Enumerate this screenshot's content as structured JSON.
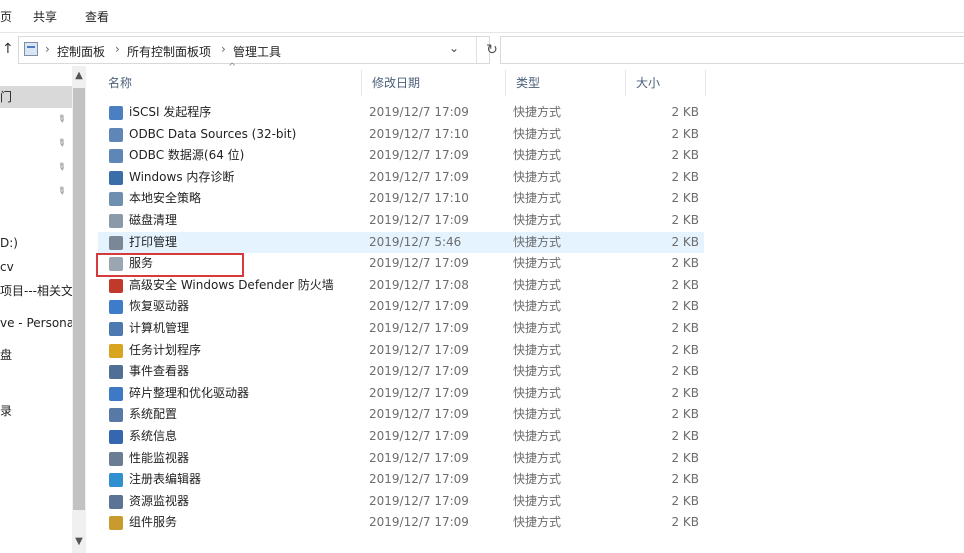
{
  "ribbon": {
    "tab_view_partial": "页",
    "tab_share": "共享",
    "tab_view": "查看"
  },
  "address": {
    "crumbs": [
      "控制面板",
      "所有控制面板项",
      "管理工具"
    ],
    "up_glyph": "↑",
    "dropdown_glyph": "⌄",
    "refresh_glyph": "↻"
  },
  "nav": {
    "items": [
      {
        "label": "门",
        "selected": true
      },
      {
        "label": ""
      },
      {
        "label": ""
      },
      {
        "label": ""
      },
      {
        "label": ""
      },
      {
        "label": ""
      },
      {
        "label": ""
      },
      {
        "label": "D:)"
      },
      {
        "label": "cv"
      },
      {
        "label": "项目---相关文"
      },
      {
        "label": "ve - Personal"
      },
      {
        "label": "盘"
      },
      {
        "label": ""
      },
      {
        "label": "录"
      }
    ],
    "pin_glyph": "📌"
  },
  "columns": {
    "name": "名称",
    "date": "修改日期",
    "type": "类型",
    "size": "大小",
    "sort_glyph": "^"
  },
  "files": [
    {
      "name": "iSCSI 发起程序",
      "date": "2019/12/7 17:09",
      "type": "快捷方式",
      "size": "2 KB",
      "icon": "iscsi-icon",
      "color": "#4a7fc1"
    },
    {
      "name": "ODBC Data Sources (32-bit)",
      "date": "2019/12/7 17:10",
      "type": "快捷方式",
      "size": "2 KB",
      "icon": "odbc-icon",
      "color": "#5e87b8"
    },
    {
      "name": "ODBC 数据源(64 位)",
      "date": "2019/12/7 17:09",
      "type": "快捷方式",
      "size": "2 KB",
      "icon": "odbc-icon",
      "color": "#5e87b8"
    },
    {
      "name": "Windows 内存诊断",
      "date": "2019/12/7 17:09",
      "type": "快捷方式",
      "size": "2 KB",
      "icon": "memory-diagnostic-icon",
      "color": "#3b6ea8"
    },
    {
      "name": "本地安全策略",
      "date": "2019/12/7 17:10",
      "type": "快捷方式",
      "size": "2 KB",
      "icon": "security-policy-icon",
      "color": "#6f8fb0"
    },
    {
      "name": "磁盘清理",
      "date": "2019/12/7 17:09",
      "type": "快捷方式",
      "size": "2 KB",
      "icon": "disk-cleanup-icon",
      "color": "#8b9aa8"
    },
    {
      "name": "打印管理",
      "date": "2019/12/7 5:46",
      "type": "快捷方式",
      "size": "2 KB",
      "icon": "print-management-icon",
      "color": "#7a8796"
    },
    {
      "name": "服务",
      "date": "2019/12/7 17:09",
      "type": "快捷方式",
      "size": "2 KB",
      "icon": "services-icon",
      "color": "#9aa6b2"
    },
    {
      "name": "高级安全 Windows Defender 防火墙",
      "date": "2019/12/7 17:08",
      "type": "快捷方式",
      "size": "2 KB",
      "icon": "firewall-icon",
      "color": "#c0392b"
    },
    {
      "name": "恢复驱动器",
      "date": "2019/12/7 17:09",
      "type": "快捷方式",
      "size": "2 KB",
      "icon": "recovery-drive-icon",
      "color": "#3d7cc9"
    },
    {
      "name": "计算机管理",
      "date": "2019/12/7 17:09",
      "type": "快捷方式",
      "size": "2 KB",
      "icon": "computer-management-icon",
      "color": "#4b79b0"
    },
    {
      "name": "任务计划程序",
      "date": "2019/12/7 17:09",
      "type": "快捷方式",
      "size": "2 KB",
      "icon": "task-scheduler-icon",
      "color": "#d9a520"
    },
    {
      "name": "事件查看器",
      "date": "2019/12/7 17:09",
      "type": "快捷方式",
      "size": "2 KB",
      "icon": "event-viewer-icon",
      "color": "#4f6f94"
    },
    {
      "name": "碎片整理和优化驱动器",
      "date": "2019/12/7 17:09",
      "type": "快捷方式",
      "size": "2 KB",
      "icon": "defrag-icon",
      "color": "#3f78c4"
    },
    {
      "name": "系统配置",
      "date": "2019/12/7 17:09",
      "type": "快捷方式",
      "size": "2 KB",
      "icon": "system-config-icon",
      "color": "#5878a6"
    },
    {
      "name": "系统信息",
      "date": "2019/12/7 17:09",
      "type": "快捷方式",
      "size": "2 KB",
      "icon": "system-info-icon",
      "color": "#3567b0"
    },
    {
      "name": "性能监视器",
      "date": "2019/12/7 17:09",
      "type": "快捷方式",
      "size": "2 KB",
      "icon": "performance-monitor-icon",
      "color": "#6a7d92"
    },
    {
      "name": "注册表编辑器",
      "date": "2019/12/7 17:09",
      "type": "快捷方式",
      "size": "2 KB",
      "icon": "registry-editor-icon",
      "color": "#2f8fcf"
    },
    {
      "name": "资源监视器",
      "date": "2019/12/7 17:09",
      "type": "快捷方式",
      "size": "2 KB",
      "icon": "resource-monitor-icon",
      "color": "#5b7394"
    },
    {
      "name": "组件服务",
      "date": "2019/12/7 17:09",
      "type": "快捷方式",
      "size": "2 KB",
      "icon": "component-services-icon",
      "color": "#c99a2e"
    }
  ],
  "hover_row_index": 6,
  "highlighted_row_index": 7,
  "highlight_color": "#d63a3a"
}
